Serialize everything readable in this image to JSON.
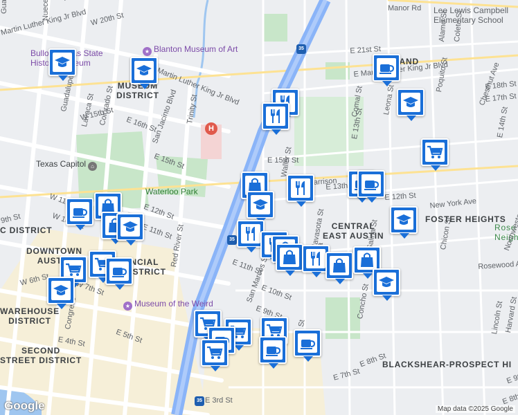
{
  "map": {
    "attribution": "Map data ©2025 Google",
    "logo": "Google",
    "districts": [
      {
        "text": "MUSEUM\nDISTRICT"
      },
      {
        "text": "C DISTRICT"
      },
      {
        "text": "DOWNTOWN\nAUSTIN"
      },
      {
        "text": "NCIAL\nDISTRICT"
      },
      {
        "text": "WAREHOUSE\nDISTRICT"
      },
      {
        "text": "SECOND\nSTREET DISTRICT"
      },
      {
        "text": "BURLAND"
      },
      {
        "text": "CENTRAL\nEAST AUSTIN"
      },
      {
        "text": "FOSTER HEIGHTS"
      },
      {
        "text": "BLACKSHEAR-PROSPECT HI"
      },
      {
        "text": "Rose\nNeighbor"
      }
    ],
    "pois": [
      {
        "text": "Blanton Museum of Art",
        "icon": "museum-icon"
      },
      {
        "text": "Bullock Texas State\nHistory Museum",
        "icon": "museum-icon"
      },
      {
        "text": "Texas Capitol",
        "icon": "landmark-icon"
      },
      {
        "text": "Waterloo Park",
        "icon": "park-icon"
      },
      {
        "text": "Museum of the Weird",
        "icon": "museum-icon"
      },
      {
        "text": "Lee Lewis Campbell\nElementary School",
        "icon": "school-icon"
      }
    ],
    "streets": [
      "Manor Rd",
      "E 21st St",
      "E Martin Luther King Jr Blvd",
      "E Martin Luther King Jr Blvd",
      "E 18th St",
      "E 17th St",
      "E 16th St",
      "E 15th St",
      "E 15th St",
      "E 13th St",
      "E 12th St",
      "E 12th St",
      "E 11th St",
      "E 11th St",
      "E 10th St",
      "E 9th St",
      "E 8th St",
      "E 7th St",
      "E 5th St",
      "E 4th St",
      "E 3rd St",
      "W 20th St",
      "W 15th St",
      "W 11th St",
      "W 7th St",
      "W 6th St",
      "W 10th St",
      "9th St",
      "Martin Luther King Jr Blvd",
      "San Jacinto Blvd",
      "Trinity St",
      "Red River St",
      "Guadalupe St",
      "Lavaca St",
      "Colorado St",
      "Nueces St",
      "Comal St",
      "Leona St",
      "Chestnut Ave",
      "Alamo St",
      "Coleto St",
      "Poquito St",
      "Salina St",
      "Chicon St",
      "Navasota St",
      "Waller St",
      "Concho St",
      "Lincoln St",
      "Harvard St",
      "Northwestern Ave",
      "Rosewood Ave",
      "New York Ave",
      "Bob Harrison",
      "San Marcos St",
      "Lydia St",
      "Congress",
      "E 14th St",
      "E 13th St",
      "E 9th St",
      "E 8th St",
      "Salina",
      "Guadalup",
      "Brazos",
      "San Antonio"
    ],
    "highway": "35",
    "hospital": "H",
    "markers": [
      {
        "icon": "school-icon"
      },
      {
        "icon": "school-icon"
      },
      {
        "icon": "coffee-icon"
      },
      {
        "icon": "school-icon"
      },
      {
        "icon": "restaurant-icon"
      },
      {
        "icon": "restaurant-icon"
      },
      {
        "icon": "shopping-cart-icon"
      },
      {
        "icon": "shopping-bag-icon"
      },
      {
        "icon": "restaurant-icon"
      },
      {
        "icon": "coffee-icon"
      },
      {
        "icon": "coffee-icon"
      },
      {
        "icon": "school-icon"
      },
      {
        "icon": "school-icon"
      },
      {
        "icon": "coffee-icon"
      },
      {
        "icon": "shopping-bag-icon"
      },
      {
        "icon": "shopping-bag-icon"
      },
      {
        "icon": "school-icon"
      },
      {
        "icon": "restaurant-icon"
      },
      {
        "icon": "restaurant-icon"
      },
      {
        "icon": "shopping-bag-icon"
      },
      {
        "icon": "shopping-bag-icon"
      },
      {
        "icon": "restaurant-icon"
      },
      {
        "icon": "shopping-bag-icon"
      },
      {
        "icon": "shopping-bag-icon"
      },
      {
        "icon": "school-icon"
      },
      {
        "icon": "shopping-cart-icon"
      },
      {
        "icon": "shopping-cart-icon"
      },
      {
        "icon": "coffee-icon"
      },
      {
        "icon": "school-icon"
      },
      {
        "icon": "shopping-cart-icon"
      },
      {
        "icon": "shopping-cart-icon"
      },
      {
        "icon": "shopping-cart-icon"
      },
      {
        "icon": "coffee-icon"
      },
      {
        "icon": "coffee-icon"
      },
      {
        "icon": "shopping-cart-icon"
      },
      {
        "icon": "coffee-icon"
      }
    ],
    "colors": {
      "marker": "#1a6fd8",
      "park": "#c8e6c9",
      "highway": "#8ab4f8",
      "water": "#9fc6f0",
      "poi": "#7c4ba8"
    }
  }
}
